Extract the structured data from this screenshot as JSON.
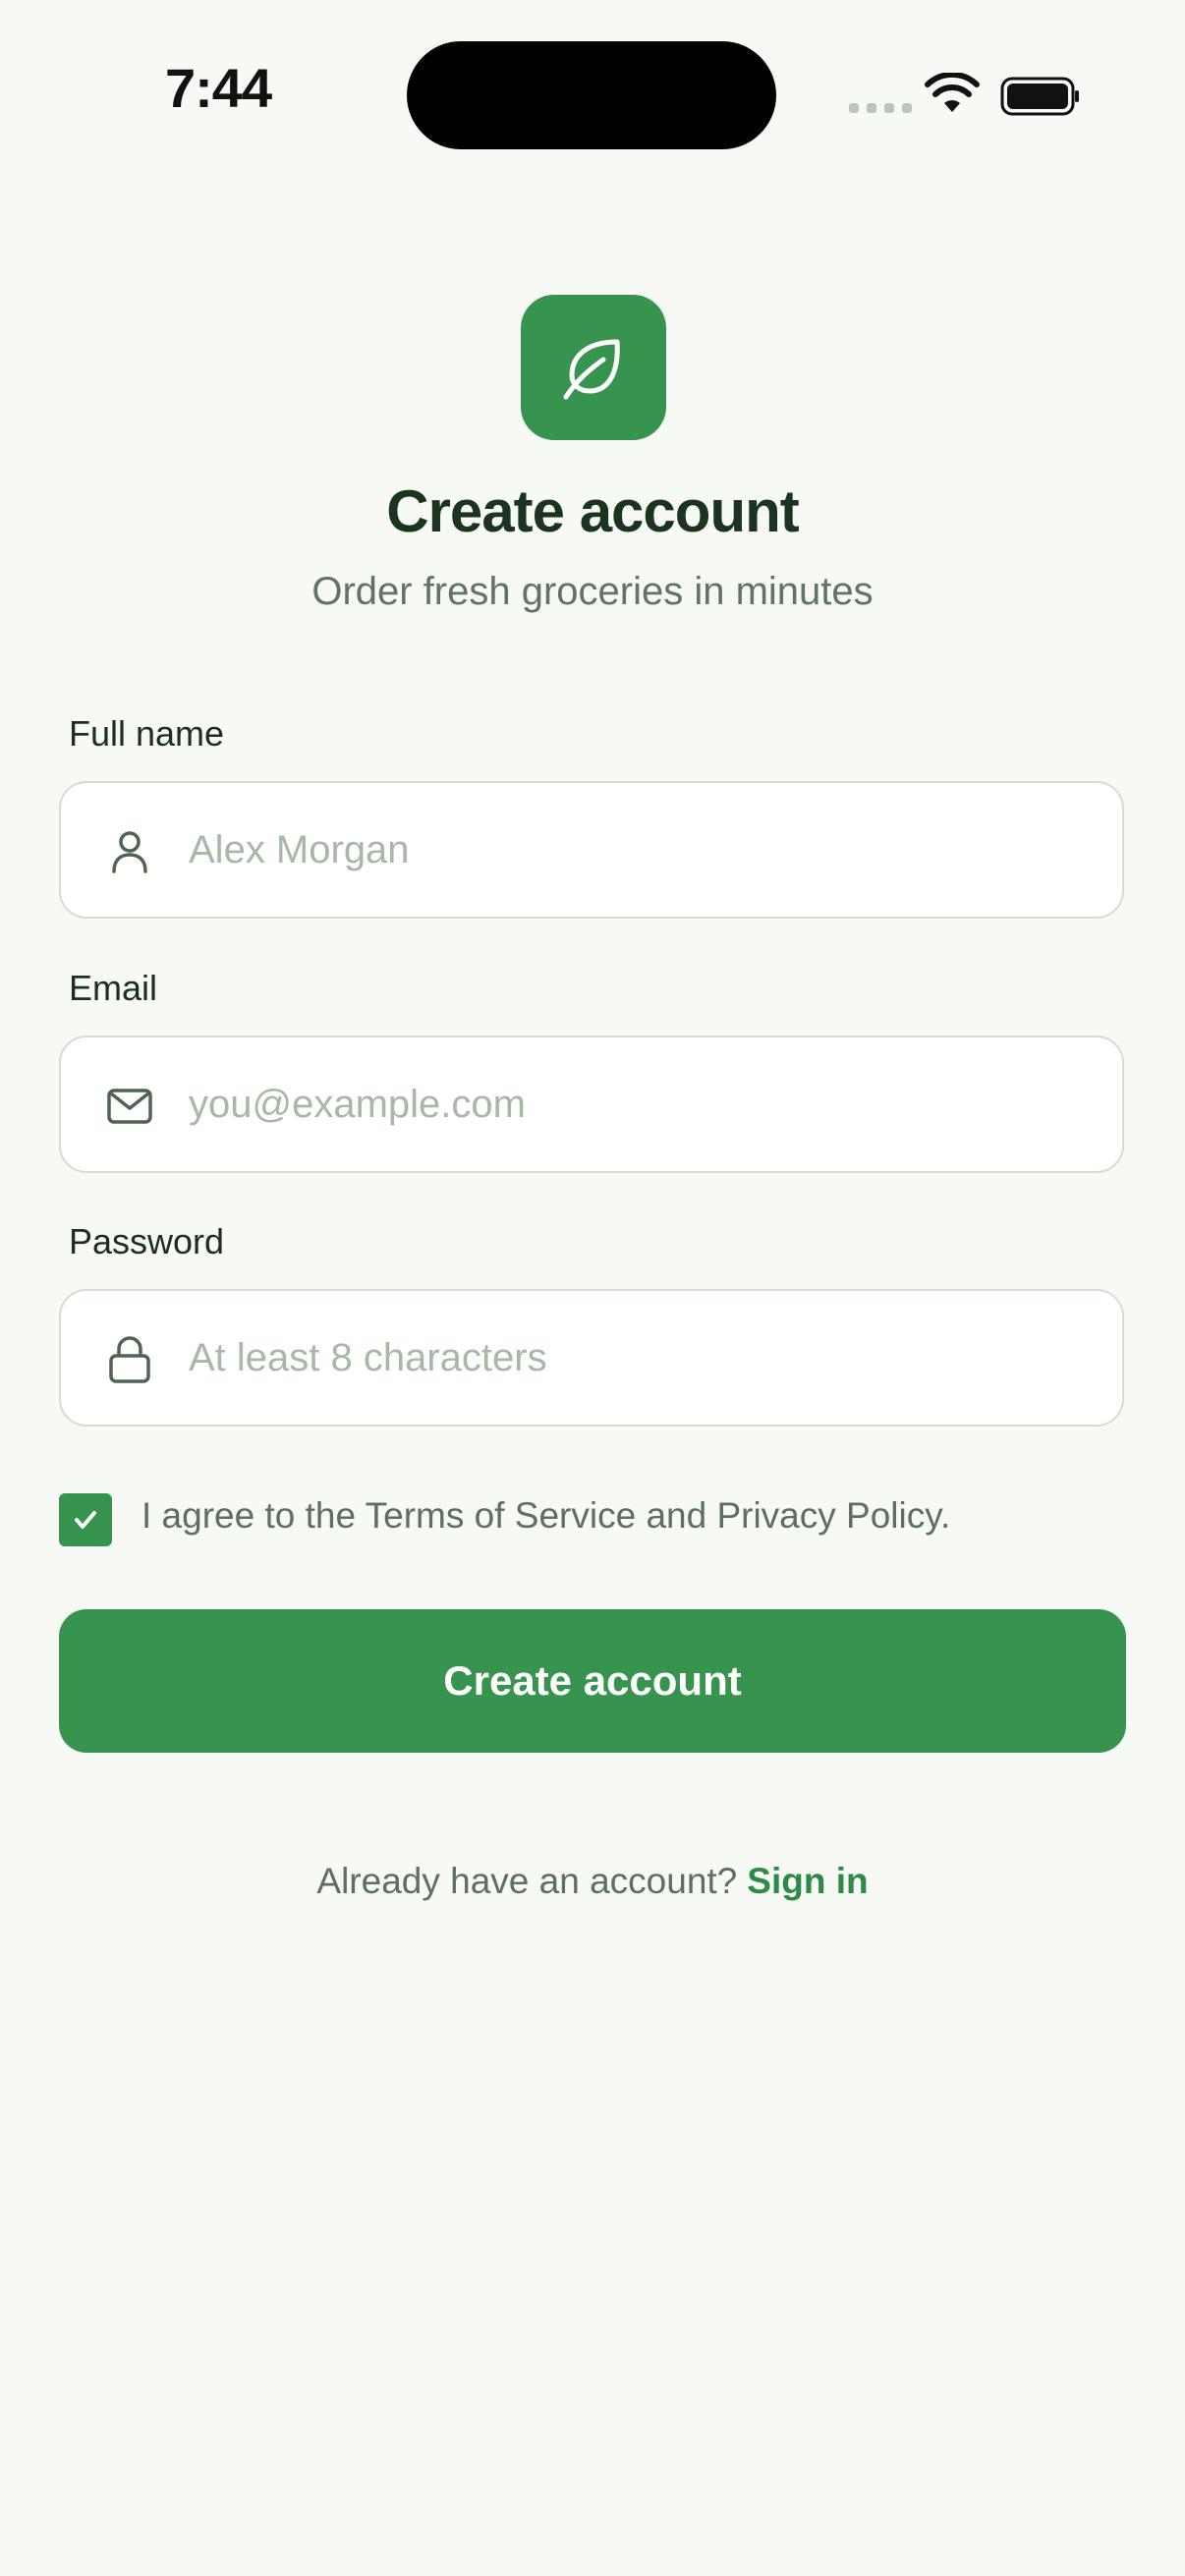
{
  "status_bar": {
    "time": "7:44"
  },
  "header": {
    "logo_icon": "leaf-icon",
    "title": "Create account",
    "subtitle": "Order fresh groceries in minutes"
  },
  "form": {
    "full_name": {
      "label": "Full name",
      "placeholder": "Alex Morgan",
      "value": "",
      "icon": "user-icon"
    },
    "email": {
      "label": "Email",
      "placeholder": "you@example.com",
      "value": "",
      "icon": "mail-icon"
    },
    "password": {
      "label": "Password",
      "placeholder": "At least 8 characters",
      "value": "",
      "icon": "lock-icon"
    },
    "terms": {
      "checked": true,
      "label": "I agree to the Terms of Service and Privacy Policy."
    },
    "submit_label": "Create account"
  },
  "footer": {
    "prompt": "Already have an account?",
    "link_label": "Sign in"
  },
  "colors": {
    "background": "#f6f9f4",
    "brand_green": "#37944e",
    "link_green": "#2f8a47",
    "text_dark": "#1a3420",
    "text_muted": "#617463",
    "placeholder": "#a7b8a6",
    "field_border": "#d4ddd2"
  }
}
